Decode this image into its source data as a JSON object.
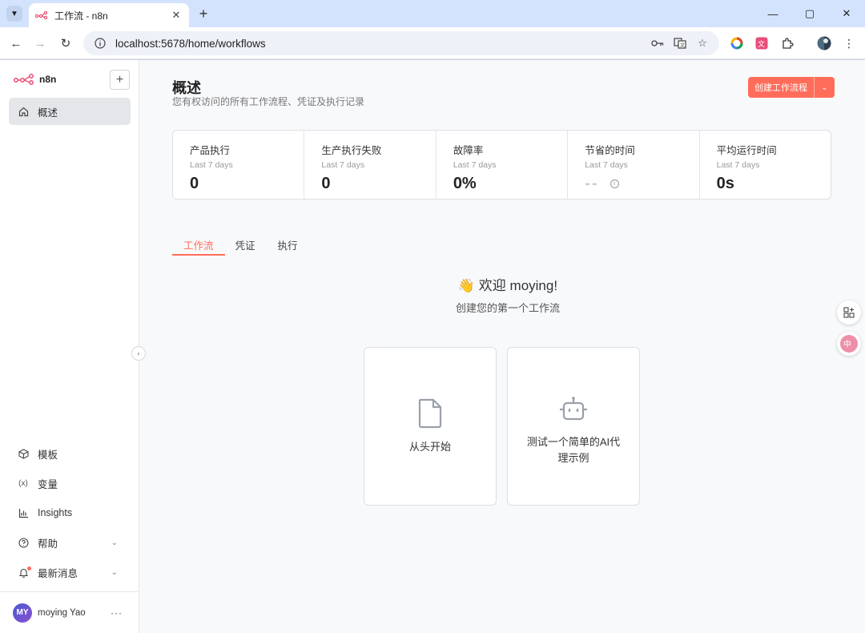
{
  "browser": {
    "tab_title": "工作流 - n8n",
    "url": "localhost:5678/home/workflows"
  },
  "sidebar": {
    "brand": "n8n",
    "add_label": "+",
    "nav": [
      {
        "label": "概述",
        "icon": "home-icon",
        "active": true
      }
    ],
    "bottom_nav": [
      {
        "label": "模板",
        "icon": "box-icon"
      },
      {
        "label": "变量",
        "icon": "variable-icon"
      },
      {
        "label": "Insights",
        "icon": "chart-icon"
      },
      {
        "label": "帮助",
        "icon": "help-icon"
      },
      {
        "label": "最新消息",
        "icon": "bell-icon"
      }
    ],
    "user": {
      "initials": "MY",
      "name": "moying Yao",
      "more": "···"
    }
  },
  "main": {
    "title": "概述",
    "subtitle": "您有权访问的所有工作流程、凭证及执行记录",
    "create_button": "创建工作流程",
    "stats": [
      {
        "label": "产品执行",
        "period": "Last 7 days",
        "value": "0"
      },
      {
        "label": "生产执行失败",
        "period": "Last 7 days",
        "value": "0"
      },
      {
        "label": "故障率",
        "period": "Last 7 days",
        "value": "0%"
      },
      {
        "label": "节省的时间",
        "period": "Last 7 days",
        "value": "--"
      },
      {
        "label": "平均运行时间",
        "period": "Last 7 days",
        "value": "0s"
      }
    ],
    "tabs": [
      "工作流",
      "凭证",
      "执行"
    ],
    "welcome": "👋 欢迎 moying!",
    "welcome_sub": "创建您的第一个工作流",
    "cards": [
      {
        "label": "从头开始",
        "icon": "file-icon"
      },
      {
        "label": "测试一个简单的AI代理示例",
        "icon": "robot-icon"
      }
    ]
  },
  "colors": {
    "accent": "#ff6d5a",
    "browser_chrome": "#d3e3fd",
    "app_bg": "#f8f9fb"
  }
}
